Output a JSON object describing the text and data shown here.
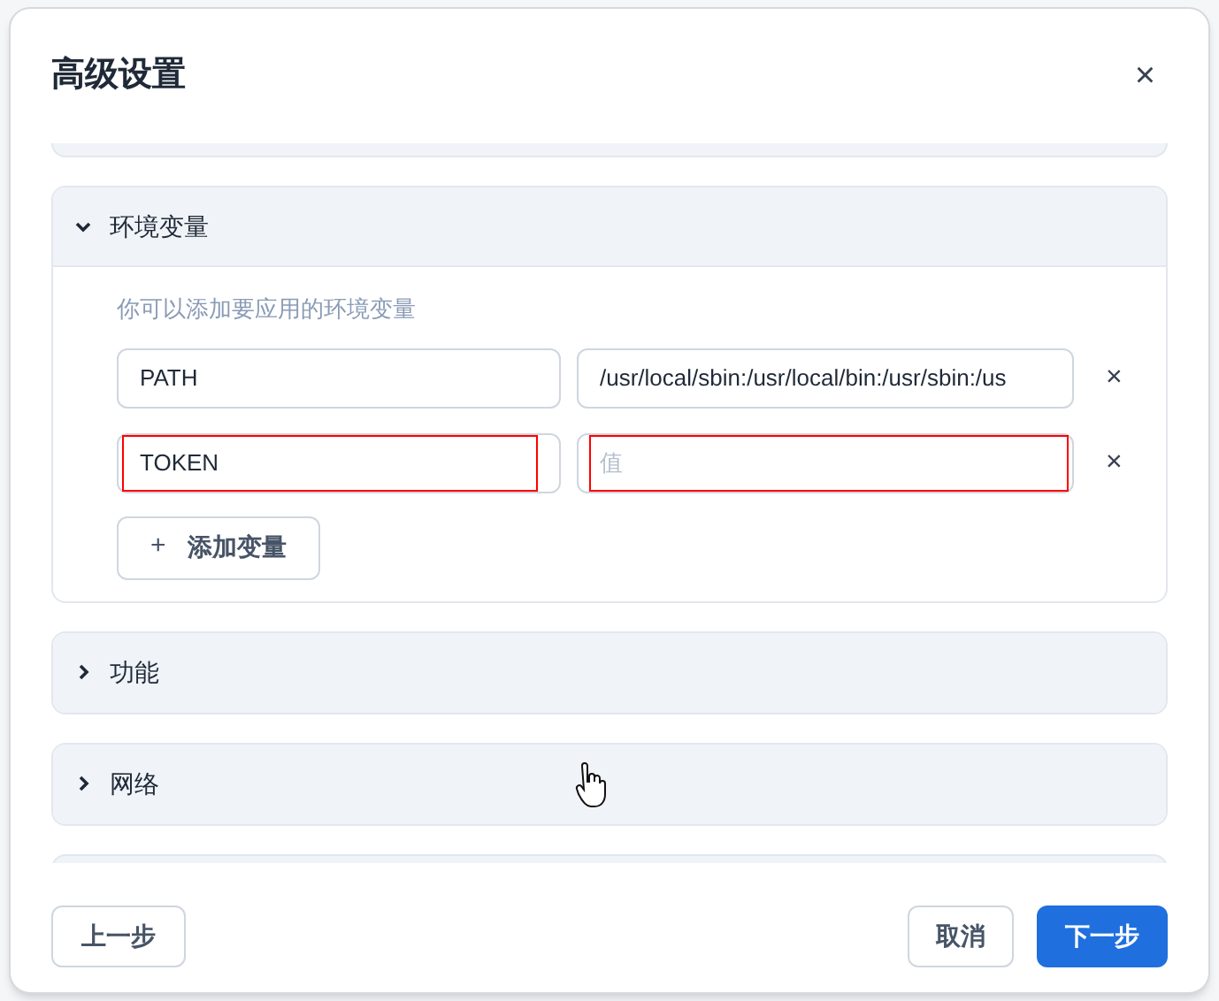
{
  "dialog": {
    "title": "高级设置",
    "close": "×"
  },
  "sections": [
    {
      "title": "环境变量",
      "expanded": true,
      "description": "你可以添加要应用的环境变量",
      "variables": [
        {
          "name": "PATH",
          "value": "/usr/local/sbin:/usr/local/bin:/usr/sbin:/us",
          "remove": "×",
          "highlighted": false
        },
        {
          "name": "TOKEN",
          "placeholder": "值",
          "remove": "×",
          "highlighted": true
        }
      ],
      "add_button": {
        "icon": "+",
        "label": "添加变量"
      }
    },
    {
      "title": "功能",
      "expanded": false
    },
    {
      "title": "网络",
      "expanded": false
    }
  ],
  "footer": {
    "back": "上一步",
    "cancel": "取消",
    "next": "下一步"
  }
}
